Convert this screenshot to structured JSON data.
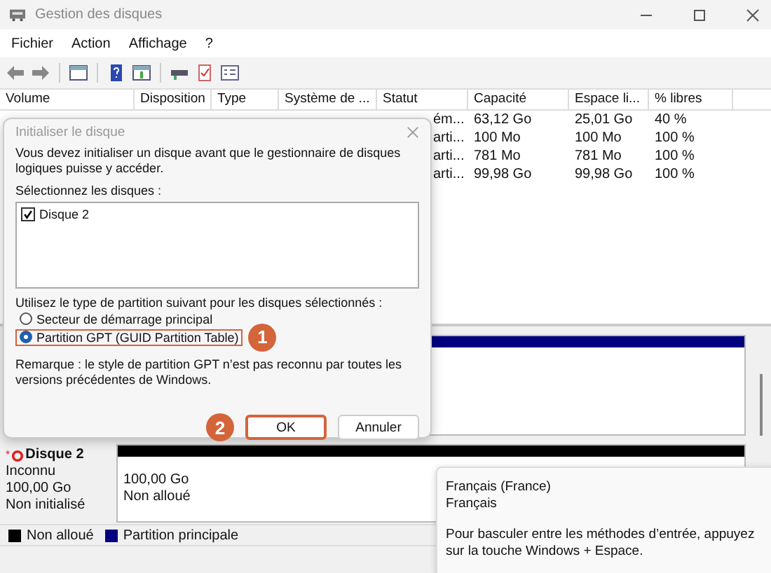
{
  "window": {
    "title": "Gestion des disques"
  },
  "menu": [
    "Fichier",
    "Action",
    "Affichage",
    "?"
  ],
  "volumes_table": {
    "columns": [
      "Volume",
      "Disposition",
      "Type",
      "Système de ...",
      "Statut",
      "Capacité",
      "Espace li...",
      "% libres"
    ],
    "rows": [
      {
        "statut": "ém...",
        "capacite": "63,12 Go",
        "espace": "25,01 Go",
        "libres": "40 %"
      },
      {
        "statut": "arti...",
        "capacite": "100 Mo",
        "espace": "100 Mo",
        "libres": "100 %"
      },
      {
        "statut": "arti...",
        "capacite": "781 Mo",
        "espace": "781 Mo",
        "libres": "100 %"
      },
      {
        "statut": "arti...",
        "capacite": "99,98 Go",
        "espace": "99,98 Go",
        "libres": "100 %"
      }
    ]
  },
  "disks": [
    {
      "partitions": [
        {
          "kind": "primary"
        }
      ]
    },
    {
      "prefix": "*",
      "name": "Disque 2",
      "type": "Inconnu",
      "size": "100,00 Go",
      "state": "Non initialisé",
      "partitions": [
        {
          "kind": "unallocated",
          "size": "100,00 Go",
          "label": "Non alloué"
        }
      ]
    }
  ],
  "legend": [
    {
      "label": "Non alloué",
      "color": "#000000"
    },
    {
      "label": "Partition principale",
      "color": "#000080"
    }
  ],
  "dialog": {
    "title": "Initialiser le disque",
    "message": "Vous devez initialiser un disque avant que le gestionnaire de disques logiques puisse y accéder.",
    "disks_label": "Sélectionnez les disques :",
    "disk_list": [
      {
        "label": "Disque 2",
        "checked": true
      }
    ],
    "partition_label": "Utilisez le type de partition suivant pour les disques sélectionnés :",
    "options": [
      {
        "label": "Secteur de démarrage principal",
        "selected": false,
        "highlighted": false
      },
      {
        "label": "Partition GPT (GUID Partition Table)",
        "selected": true,
        "highlighted": true,
        "callout": "1"
      }
    ],
    "note": "Remarque : le style de partition GPT n’est pas reconnu par toutes les versions précédentes de Windows.",
    "buttons": [
      {
        "label": "OK",
        "highlighted": true,
        "callout": "2"
      },
      {
        "label": "Annuler",
        "highlighted": false
      }
    ]
  },
  "tooltip": {
    "lines": [
      "Français (France)",
      "Français"
    ],
    "hint": "Pour basculer entre les méthodes d’entrée, appuyez sur la touche Windows + Espace."
  }
}
